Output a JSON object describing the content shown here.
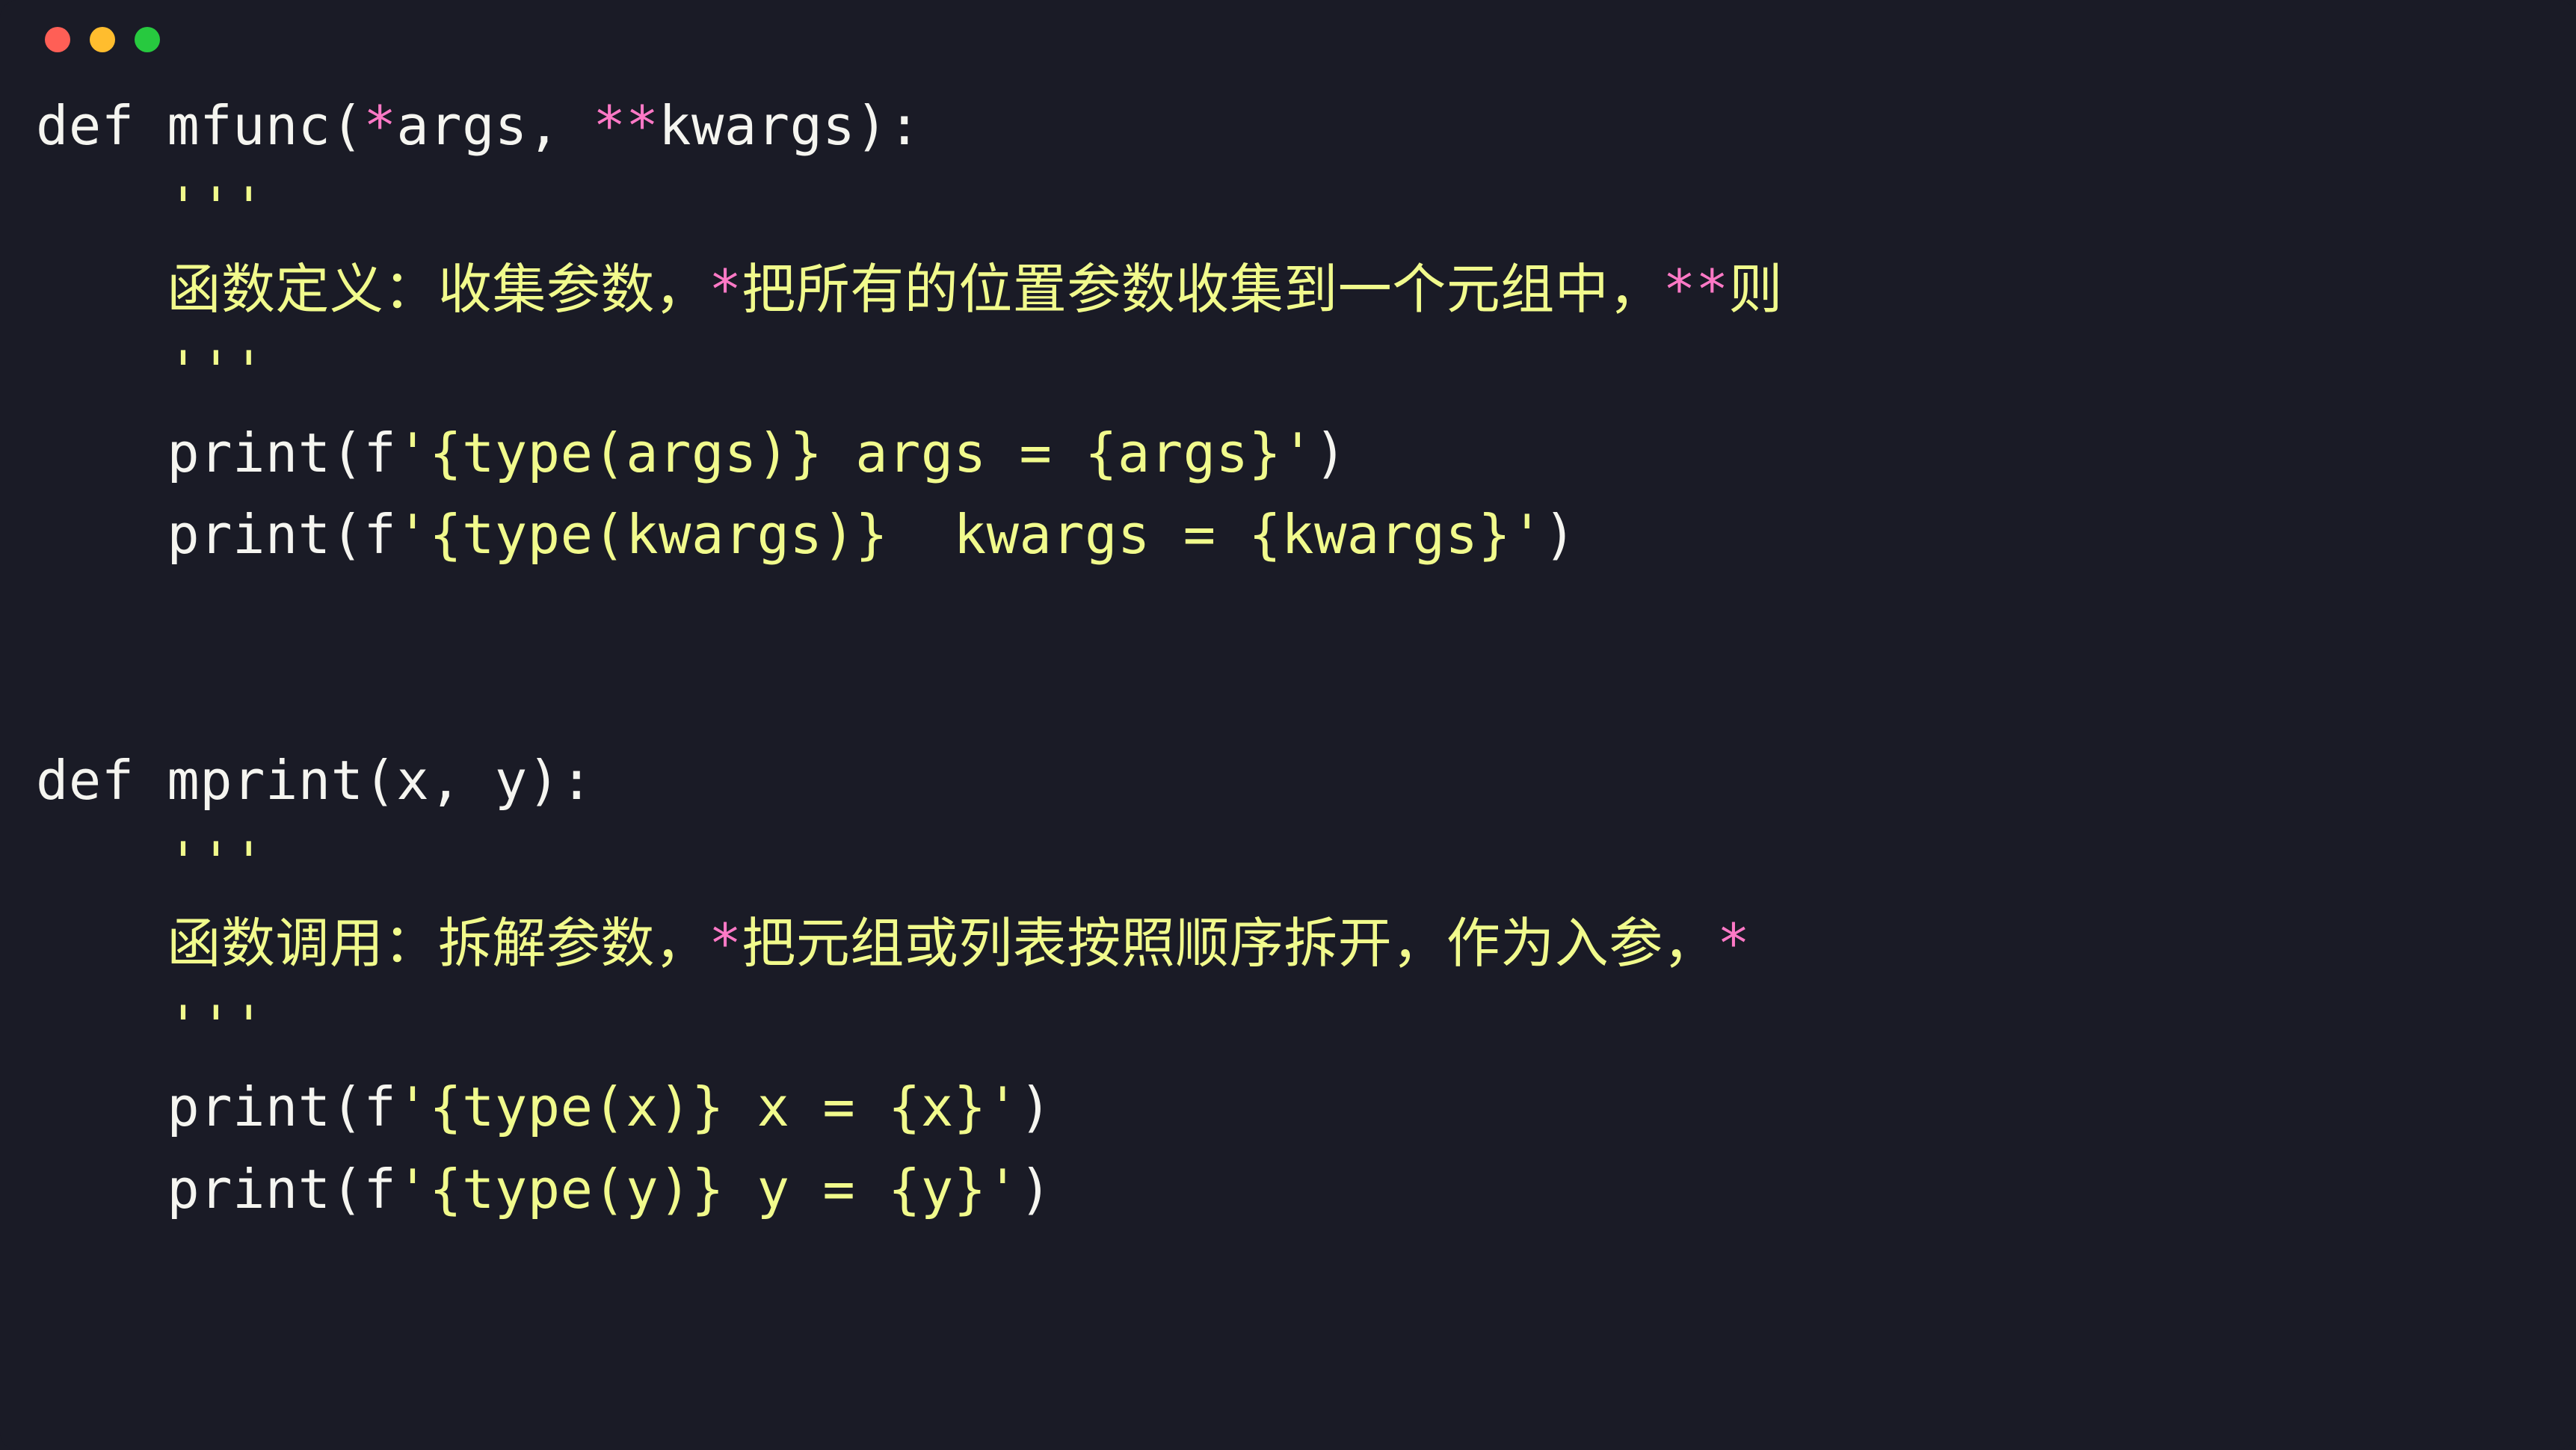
{
  "colors": {
    "background": "#1a1b26",
    "dot_red": "#ff5f56",
    "dot_yellow": "#ffbd2e",
    "dot_green": "#27c93f",
    "keyword": "#f5f5f0",
    "operator_pink": "#ff79c6",
    "string_yellow": "#f1fa8c",
    "text_white": "#f5f5f0"
  },
  "code": {
    "line1": {
      "kw_def": "def",
      "fn_name": "mfunc",
      "star1": "*",
      "arg1": "args",
      "comma": ", ",
      "star2": "**",
      "arg2": "kwargs",
      "tail": "):"
    },
    "line2": {
      "indent": "    ",
      "quotes": "'''"
    },
    "line3": {
      "indent": "    ",
      "pre": "函数定义：收集参数，",
      "star1": "*",
      "mid": "把所有的位置参数收集到一个元组中，",
      "star2": "**",
      "tail": "则"
    },
    "line4": {
      "indent": "    ",
      "quotes": "'''"
    },
    "line5": {
      "indent": "    ",
      "fn": "print",
      "open": "(f",
      "str": "'{type(args)} args = {args}'",
      "close": ")"
    },
    "line6": {
      "indent": "    ",
      "fn": "print",
      "open": "(f",
      "str": "'{type(kwargs)}  kwargs = {kwargs}'",
      "close": ")"
    },
    "line9": {
      "kw_def": "def",
      "fn_name": "mprint",
      "args": "(x, y):"
    },
    "line10": {
      "indent": "    ",
      "quotes": "'''"
    },
    "line11": {
      "indent": "    ",
      "pre": "函数调用：拆解参数，",
      "star1": "*",
      "mid": "把元组或列表按照顺序拆开，作为入参，",
      "star2": "*",
      "tail": ""
    },
    "line12": {
      "indent": "    ",
      "quotes": "'''"
    },
    "line13": {
      "indent": "    ",
      "fn": "print",
      "open": "(f",
      "str": "'{type(x)} x = {x}'",
      "close": ")"
    },
    "line14": {
      "indent": "    ",
      "fn": "print",
      "open": "(f",
      "str": "'{type(y)} y = {y}'",
      "close": ")"
    }
  }
}
